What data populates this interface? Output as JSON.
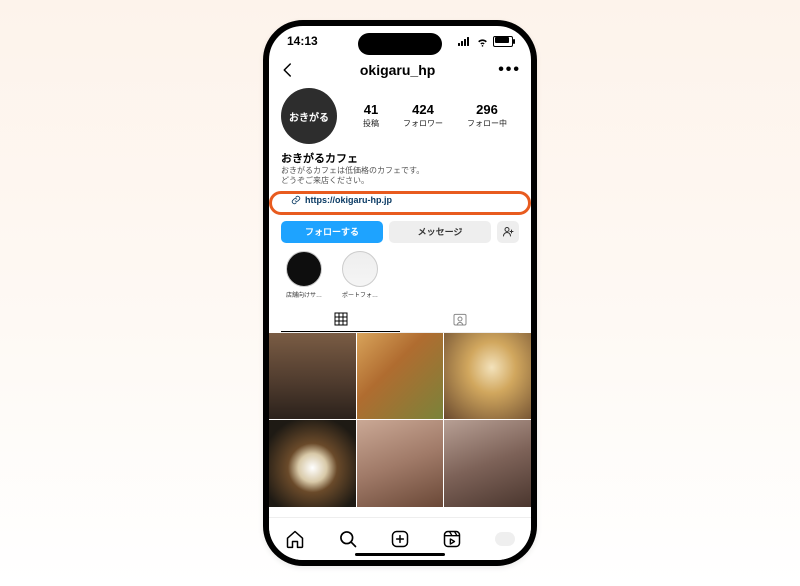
{
  "status": {
    "time": "14:13"
  },
  "header": {
    "username": "okigaru_hp"
  },
  "profile": {
    "avatar_text": "おきがる",
    "stats": {
      "posts_n": "41",
      "posts_l": "投稿",
      "followers_n": "424",
      "followers_l": "フォロワー",
      "following_n": "296",
      "following_l": "フォロー中"
    },
    "display_name": "おきがるカフェ",
    "bio_line1": "おきがるカフェは低価格のカフェです。",
    "bio_line2": "どうぞご来店ください。",
    "link_url": "https://okigaru-hp.jp"
  },
  "buttons": {
    "follow": "フォローする",
    "message": "メッセージ"
  },
  "highlights": [
    {
      "label": "店舗向けサ…"
    },
    {
      "label": "ポートフォ…"
    }
  ],
  "highlight_annotation": "https://okigaru-hp.jp へのリンクをハイライト",
  "colors": {
    "follow_bg": "#1ea3ff",
    "annotation": "#e85b1f",
    "link": "#0a3a63"
  }
}
